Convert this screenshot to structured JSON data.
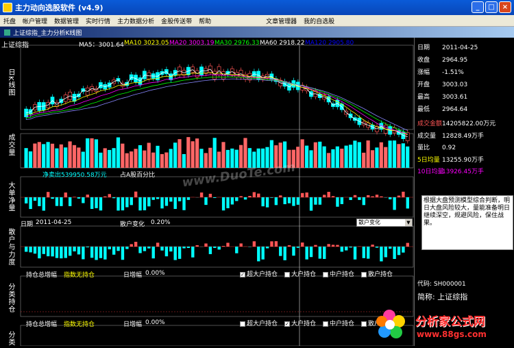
{
  "window": {
    "title": "主力动向选股软件 (v4.9)",
    "buttons": [
      "_",
      "□",
      "×"
    ]
  },
  "menu": [
    "托盘",
    "帐户管理",
    "数据管理",
    "实时行情",
    "主力数据分析",
    "金股传送带",
    "帮助",
    "文章管理器",
    "我的自选股"
  ],
  "doc": {
    "title": "上证综指_主力分析K线图"
  },
  "chart": {
    "stock_name": "上证综指",
    "ma_labels": [
      {
        "text": "MA5：3001.64",
        "color": "#ffffff"
      },
      {
        "text": "MA10 3023.05",
        "color": "#ffff00"
      },
      {
        "text": "MA20 3003.19",
        "color": "#ff00ff"
      },
      {
        "text": "MA30 2976.33",
        "color": "#00ff00"
      },
      {
        "text": "MA60 2918.22",
        "color": "#ffffff"
      },
      {
        "text": "MA120 2905.80",
        "color": "#0000ff"
      }
    ],
    "side_labels": {
      "kline": "日K线图",
      "volume": "成交量",
      "big_order": "大单净量",
      "retail": "散户与力度",
      "holding": "分类持仓",
      "holding2": "分类"
    },
    "net_sell": "净卖出539950.58万元",
    "bull_pct": "占A股百分比",
    "date_label": "日期",
    "date_value": "2011-04-25",
    "retail_change_label": "散户变化",
    "retail_change_value": "0.20%",
    "combo_value": "散户变化",
    "hold_total_label": "持仓总增幅",
    "hold_total_value": "指数无持仓",
    "day_inc_label": "日增幅",
    "day_inc_value": "0.00%",
    "checks1": [
      {
        "label": "超大户持仓",
        "on": true
      },
      {
        "label": "大户持仓",
        "on": false
      },
      {
        "label": "中户持仓",
        "on": false
      },
      {
        "label": "散户持仓",
        "on": false
      }
    ],
    "checks2": [
      {
        "label": "超大户持仓",
        "on": false
      },
      {
        "label": "大户持仓",
        "on": true
      },
      {
        "label": "中户持仓",
        "on": false
      },
      {
        "label": "散户持仓",
        "on": false
      }
    ]
  },
  "info": {
    "rows": [
      {
        "k": "日期",
        "v": "2011-04-25",
        "kc": "#ffffff",
        "vc": "#ffffff"
      },
      {
        "k": "收盘",
        "v": "2964.95",
        "kc": "#ffffff",
        "vc": "#ffffff"
      },
      {
        "k": "涨幅",
        "v": "-1.51%",
        "kc": "#ffffff",
        "vc": "#ffffff"
      },
      {
        "k": "开盘",
        "v": "3003.03",
        "kc": "#ffffff",
        "vc": "#ffffff"
      },
      {
        "k": "最高",
        "v": "3003.61",
        "kc": "#ffffff",
        "vc": "#ffffff"
      },
      {
        "k": "最低",
        "v": "2964.64",
        "kc": "#ffffff",
        "vc": "#ffffff"
      }
    ],
    "rows2": [
      {
        "k": "成交金额",
        "v": "14205822.00万元",
        "kc": "#ff5555",
        "vc": "#ffffff"
      },
      {
        "k": "成交量",
        "v": "12828.49万手",
        "kc": "#ffffff",
        "vc": "#ffffff"
      },
      {
        "k": "量比",
        "v": "0.92",
        "kc": "#ffffff",
        "vc": "#ffffff"
      },
      {
        "k": "5日均量",
        "v": "13255.90万手",
        "kc": "#ffff00",
        "vc": "#ffffff"
      },
      {
        "k": "10日均量",
        "v": "13926.45万手",
        "kc": "#ff00ff",
        "vc": "#ff00ff"
      }
    ],
    "desc": "根据大盘预测模型综合判断，明日大盘风险较大，量能准备明日继续深空，规避风险，保住战果。",
    "code_label": "代码:",
    "code_value": "SH000001",
    "name_label": "简称:",
    "name_value": "上证综指"
  },
  "watermark": "www.DuoTe.com",
  "logo": {
    "text": "分析家公式网",
    "url": "www.88gs.com"
  }
}
